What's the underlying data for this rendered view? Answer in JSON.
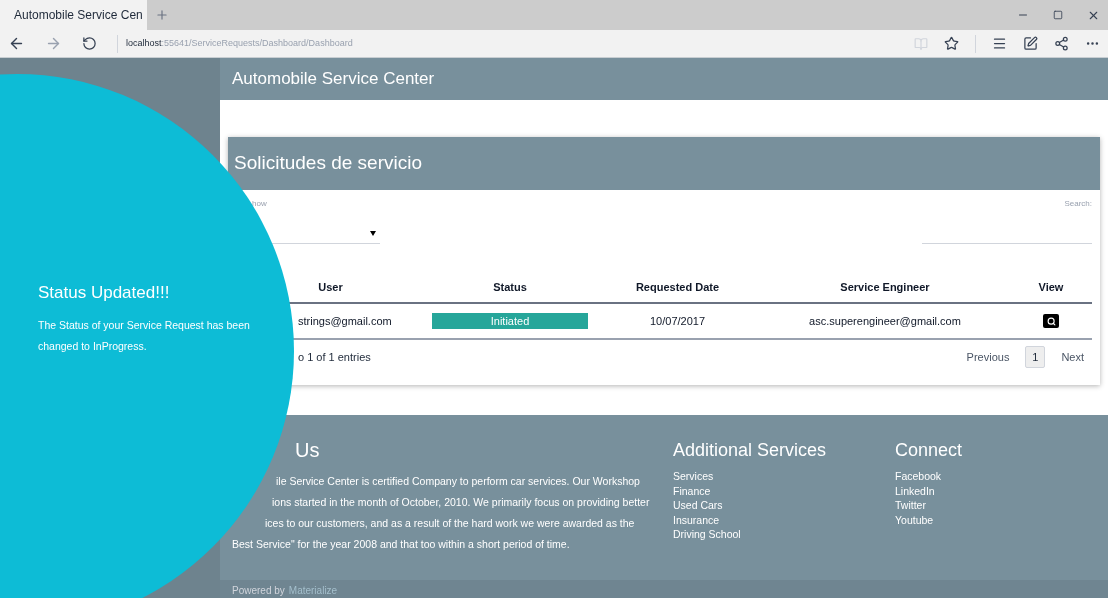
{
  "browser": {
    "tab_title": "Automobile Service Cen",
    "url": {
      "host": "localhost",
      "path": ":55641/ServiceRequests/Dashboard/Dashboard"
    }
  },
  "header": {
    "title": "Automobile Service Center"
  },
  "card": {
    "title": "Solicitudes de servicio",
    "show_label": "how",
    "search_label": "Search:",
    "columns": [
      "User",
      "Status",
      "Requested Date",
      "Service Engineer",
      "View"
    ],
    "rows": [
      {
        "user": "strings@gmail.com",
        "status": "Initiated",
        "date": "10/07/2017",
        "engineer": "asc.superengineer@gmail.com"
      }
    ],
    "entries": "o 1 of 1 entries",
    "pagination": {
      "previous": "Previous",
      "next": "Next",
      "pages": [
        {
          "label": "1",
          "selected": true
        }
      ]
    }
  },
  "footer": {
    "about": {
      "title": "Us",
      "lines": [
        "ile Service Center is certified Company to perform car services. Our Workshop",
        "ions started in the month of October, 2010. We primarily focus on providing better",
        "ices to our customers, and as a result of the hard work we were awarded as the",
        "Best Service\" for the year 2008 and that too within a short period of time."
      ]
    },
    "sections": [
      {
        "title": "Additional Services",
        "links": [
          "Services",
          "Finance",
          "Used Cars",
          "Insurance",
          "Driving School"
        ]
      },
      {
        "title": "Connect",
        "links": [
          "Facebook",
          "LinkedIn",
          "Twitter",
          "Youtube"
        ]
      }
    ],
    "powered": "Powered by",
    "powered_link": "Materialize"
  },
  "toast": {
    "title": "Status Updated!!!",
    "message": "The Status of your Service Request has been changed to InProgress."
  }
}
